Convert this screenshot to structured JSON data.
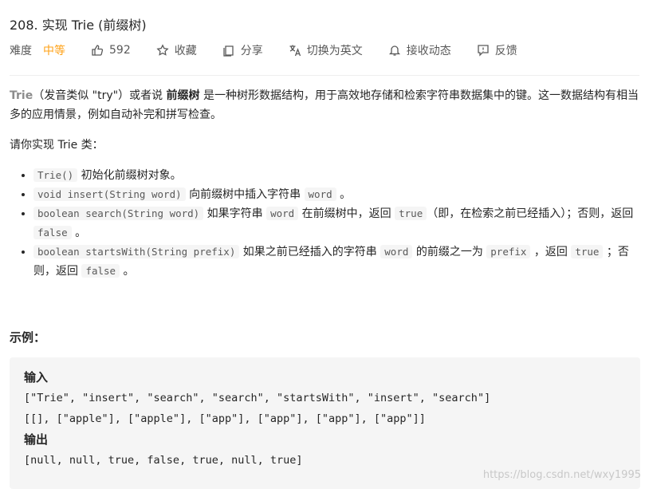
{
  "problem": {
    "title": "208. 实现 Trie (前缀树)"
  },
  "toolbar": {
    "difficulty_label": "难度",
    "difficulty_value": "中等",
    "likes": "592",
    "favorite_label": "收藏",
    "share_label": "分享",
    "lang_label": "切换为英文",
    "subscribe_label": "接收动态",
    "feedback_label": "反馈",
    "colors": {
      "difficulty": "#ffa116"
    }
  },
  "description": {
    "intro_kw": "Trie",
    "intro_a": "（发音类似 \"try\"）或者说 ",
    "intro_bold": "前缀树",
    "intro_b": " 是一种树形数据结构，用于高效地存储和检索字符串数据集中的键。这一数据结构有相当多的应用情景，例如自动补完和拼写检查。",
    "task": "请你实现 Trie 类：",
    "items": [
      {
        "code1": "Trie()",
        "text1": " 初始化前缀树对象。"
      },
      {
        "code1": "void insert(String word)",
        "text1": " 向前缀树中插入字符串 ",
        "code2": "word",
        "text2": " 。"
      },
      {
        "code1": "boolean search(String word)",
        "text1": " 如果字符串 ",
        "code2": "word",
        "text2": " 在前缀树中，返回 ",
        "code3": "true",
        "text3": "（即，在检索之前已经插入）；否则，返回 ",
        "code4": "false",
        "text4": " 。"
      },
      {
        "code1": "boolean startsWith(String prefix)",
        "text1": " 如果之前已经插入的字符串 ",
        "code2": "word",
        "text2": " 的前缀之一为 ",
        "code3": "prefix",
        "text3": " ，返回 ",
        "code4": "true",
        "text4": " ；否则，返回 ",
        "code5": "false",
        "text5": " 。"
      }
    ]
  },
  "example": {
    "heading": "示例：",
    "input_label": "输入",
    "input_line1": "[\"Trie\", \"insert\", \"search\", \"search\", \"startsWith\", \"insert\", \"search\"]",
    "input_line2": "[[], [\"apple\"], [\"apple\"], [\"app\"], [\"app\"], [\"app\"], [\"app\"]]",
    "output_label": "输出",
    "output_line": "[null, null, true, false, true, null, true]"
  },
  "watermark": "https://blog.csdn.net/wxy1995"
}
